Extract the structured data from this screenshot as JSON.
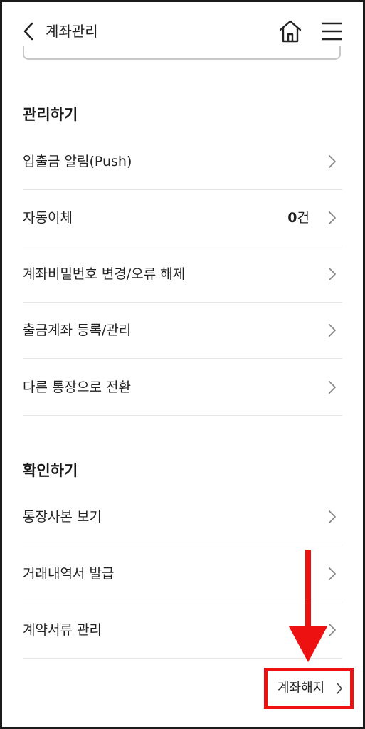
{
  "header": {
    "title": "계좌관리"
  },
  "sections": [
    {
      "title": "관리하기",
      "items": [
        {
          "label": "입출금 알림(Push)"
        },
        {
          "label": "자동이체",
          "count_value": "0",
          "count_unit": "건"
        },
        {
          "label": "계좌비밀번호 변경/오류 해제"
        },
        {
          "label": "출금계좌 등록/관리"
        },
        {
          "label": "다른 통장으로 전환"
        }
      ]
    },
    {
      "title": "확인하기",
      "items": [
        {
          "label": "통장사본 보기"
        },
        {
          "label": "거래내역서 발급"
        },
        {
          "label": "계약서류 관리"
        }
      ]
    }
  ],
  "footer": {
    "terminate_label": "계좌해지"
  },
  "colors": {
    "annotation": "#ee1111",
    "divider": "#e6e6e6",
    "text": "#222222"
  },
  "icons": {
    "back": "chevron-left-icon",
    "home": "home-icon",
    "menu": "hamburger-menu-icon",
    "row": "chevron-right-icon"
  }
}
